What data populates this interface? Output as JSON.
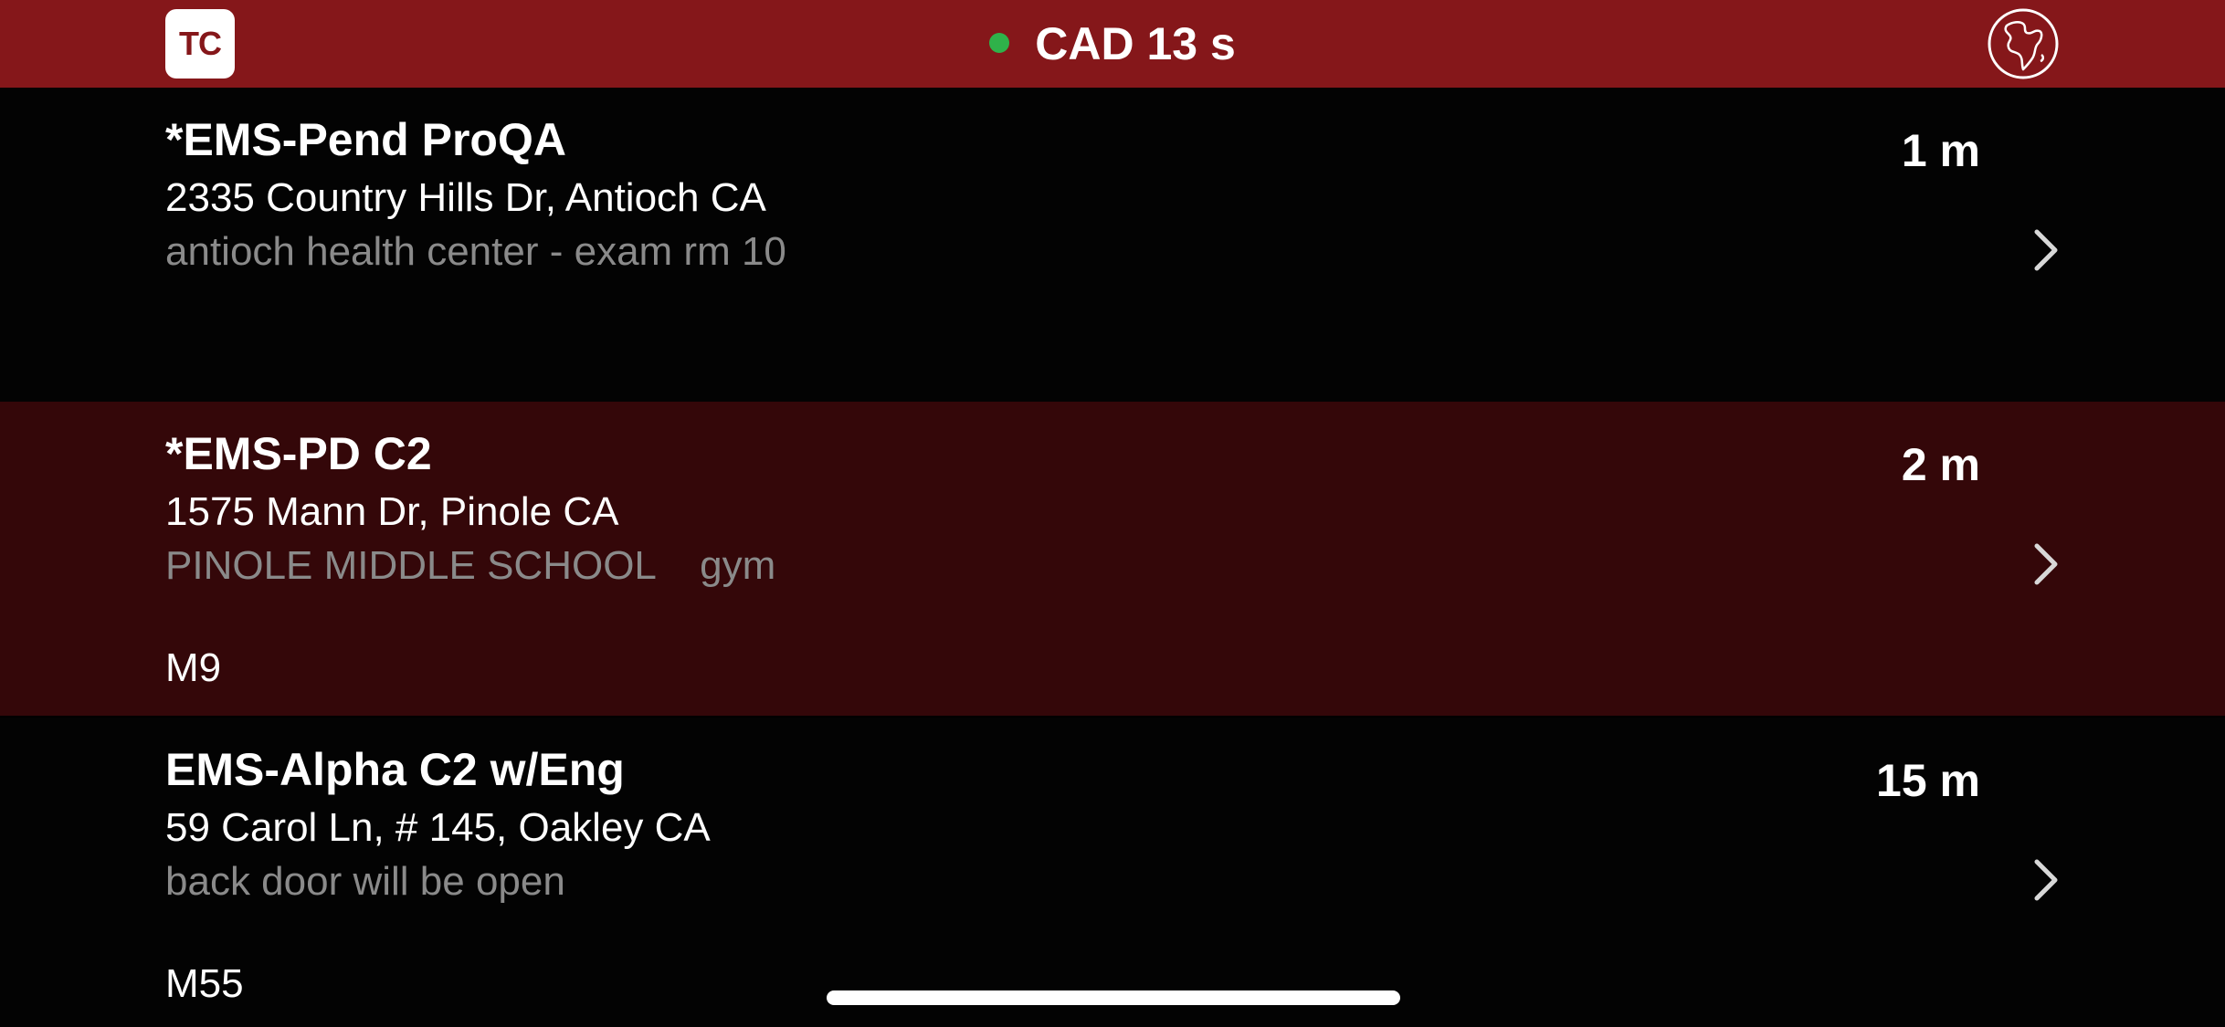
{
  "header": {
    "app_badge": "TC",
    "status_color": "#2fb24a",
    "title": "CAD 13 s",
    "globe_icon": "globe-icon",
    "background": "#85171a"
  },
  "incidents": [
    {
      "type": "*EMS-Pend ProQA",
      "address": "2335 Country Hills Dr, Antioch CA",
      "note": "antioch health center - exam rm 10",
      "unit": "",
      "age": "1 m",
      "background": "#030303"
    },
    {
      "type": "*EMS-PD C2",
      "address": "1575 Mann Dr, Pinole CA",
      "note": "PINOLE MIDDLE SCHOOL    gym",
      "unit": "M9",
      "age": "2 m",
      "background": "#340709"
    },
    {
      "type": "EMS-Alpha C2 w/Eng",
      "address": "59 Carol Ln, # 145, Oakley CA",
      "note": "back door will be open",
      "unit": "M55",
      "age": "15 m",
      "background": "#030303"
    }
  ]
}
